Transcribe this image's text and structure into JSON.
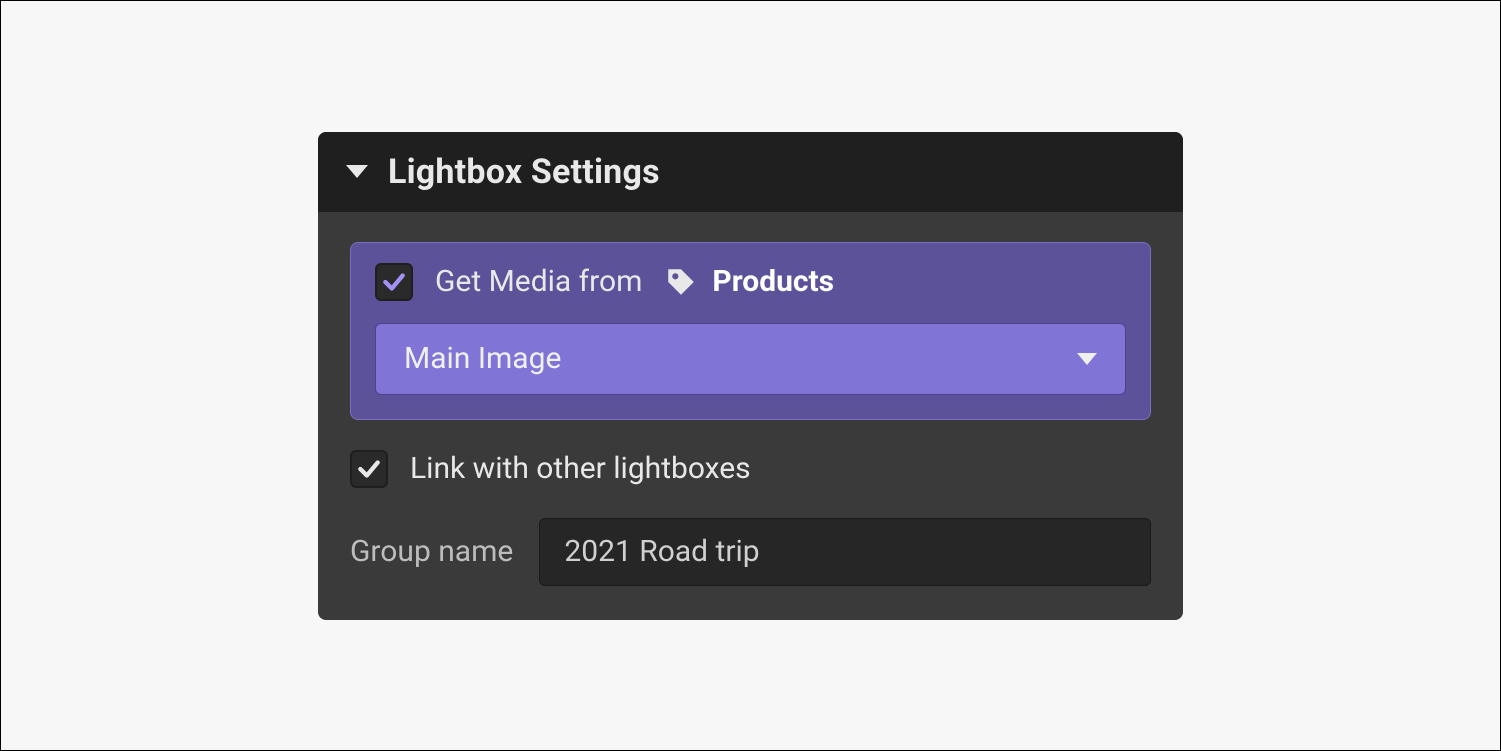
{
  "panel": {
    "title": "Lightbox Settings",
    "media": {
      "checkbox_checked": true,
      "label": "Get Media from",
      "source": "Products",
      "select_value": "Main Image"
    },
    "link": {
      "checkbox_checked": true,
      "label": "Link with other lightboxes"
    },
    "group": {
      "label": "Group name",
      "value": "2021 Road trip"
    }
  }
}
